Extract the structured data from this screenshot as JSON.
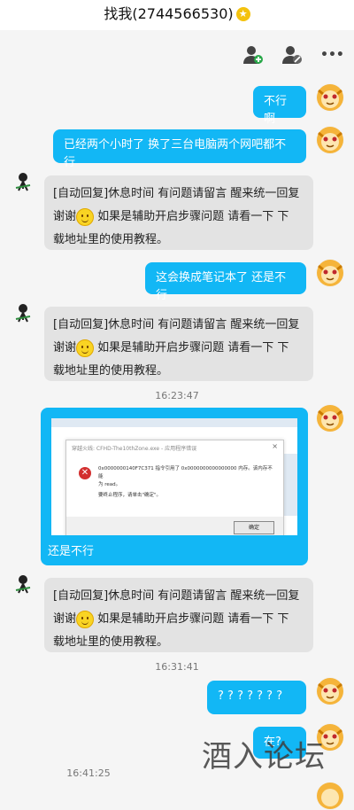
{
  "title": {
    "text": "找我(2744566530)",
    "star": "★"
  },
  "toolbar": {
    "icons": [
      "add-friend-icon",
      "block-user-icon",
      "more-icon"
    ],
    "more_label": "•••"
  },
  "messages": {
    "m1": "不行啊",
    "m2": "已经两个小时了 换了三台电脑两个网吧都不行",
    "auto_line1": "[自动回复]休息时间  有问题请留言 醒来统一回复",
    "auto_line2a": "谢谢",
    "auto_line2b": "  如果是辅助开启步骤问题  请看一下  下",
    "auto_line3": "载地址里的使用教程。",
    "m4": "这会换成笔记本了 还是不行",
    "ts1": "16:23:47",
    "err_caption": "还是不行",
    "ts2": "16:31:41",
    "m6": "? ? ? ? ? ? ?",
    "m7": "在?",
    "ts3": "16:41:25"
  },
  "error_dialog": {
    "title": "穿越火线: CFHD-The10thZone.exe - 应用程序错误",
    "close": "×",
    "line1": "0x0000000140F7C371 指令引用了 0x0000000000000000 内存。该内存不能",
    "line2": "为 read。",
    "line3": "要终止程序，请单击\"确定\"。",
    "ok": "确定",
    "icon": "error-x-icon"
  },
  "watermark": "酒入论坛",
  "colors": {
    "accent": "#12b7f5",
    "incoming": "#e3e3e3",
    "background": "#f5f5f5"
  }
}
